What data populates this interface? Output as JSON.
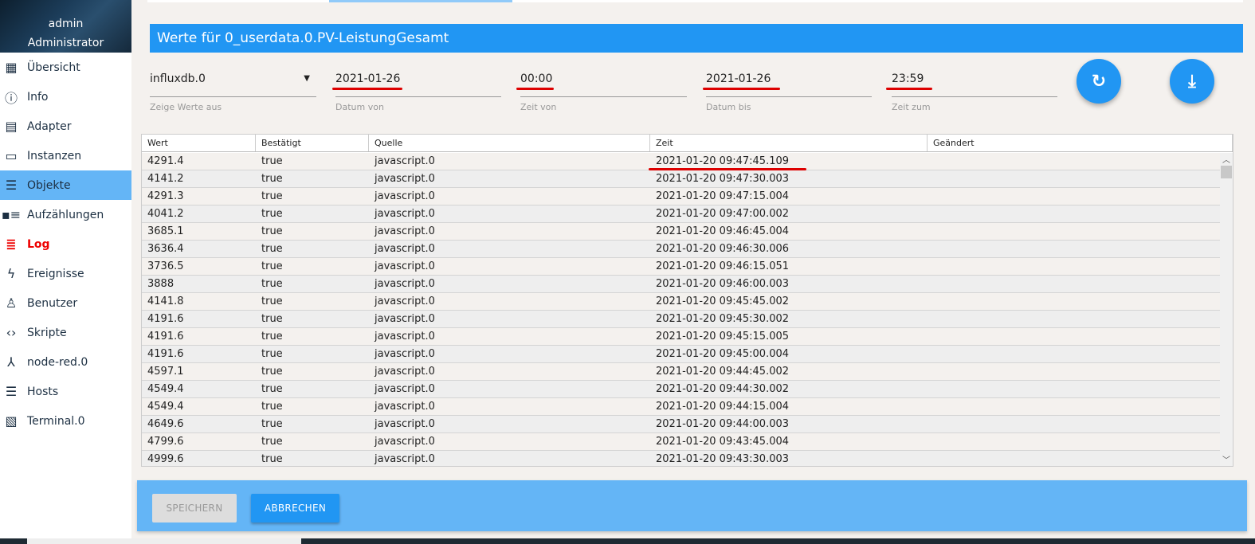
{
  "user": {
    "name": "admin",
    "role": "Administrator"
  },
  "nav": [
    {
      "label": "Übersicht",
      "icon": "grid-icon"
    },
    {
      "label": "Info",
      "icon": "info-icon"
    },
    {
      "label": "Adapter",
      "icon": "store-icon"
    },
    {
      "label": "Instanzen",
      "icon": "instances-icon"
    },
    {
      "label": "Objekte",
      "icon": "list-icon",
      "selected": true
    },
    {
      "label": "Aufzählungen",
      "icon": "enum-icon"
    },
    {
      "label": "Log",
      "icon": "log-icon"
    },
    {
      "label": "Ereignisse",
      "icon": "flash-icon"
    },
    {
      "label": "Benutzer",
      "icon": "user-icon"
    },
    {
      "label": "Skripte",
      "icon": "code-icon"
    },
    {
      "label": "node-red.0",
      "icon": "node-red-icon"
    },
    {
      "label": "Hosts",
      "icon": "hosts-icon"
    },
    {
      "label": "Terminal.0",
      "icon": "terminal-image-icon"
    }
  ],
  "dialog": {
    "title": "Werte für 0_userdata.0.PV-LeistungGesamt",
    "instance": {
      "value": "influxdb.0",
      "label": "Zeige Werte aus"
    },
    "date_from": {
      "value": "2021-01-26",
      "label": "Datum von"
    },
    "time_from": {
      "value": "00:00",
      "label": "Zeit von"
    },
    "date_to": {
      "value": "2021-01-26",
      "label": "Datum bis"
    },
    "time_to": {
      "value": "23:59",
      "label": "Zeit zum"
    },
    "save": "SPEICHERN",
    "cancel": "ABBRECHEN"
  },
  "colors": {
    "accent": "#2196f3",
    "selected": "#64b5f6",
    "log": "#e00000",
    "annotation": "#d00000"
  },
  "table": {
    "columns": [
      "Wert",
      "Bestätigt",
      "Quelle",
      "Zeit",
      "Geändert"
    ],
    "rows": [
      [
        "4291.4",
        "true",
        "javascript.0",
        "2021-01-20 09:47:45.109",
        ""
      ],
      [
        "4141.2",
        "true",
        "javascript.0",
        "2021-01-20 09:47:30.003",
        ""
      ],
      [
        "4291.3",
        "true",
        "javascript.0",
        "2021-01-20 09:47:15.004",
        ""
      ],
      [
        "4041.2",
        "true",
        "javascript.0",
        "2021-01-20 09:47:00.002",
        ""
      ],
      [
        "3685.1",
        "true",
        "javascript.0",
        "2021-01-20 09:46:45.004",
        ""
      ],
      [
        "3636.4",
        "true",
        "javascript.0",
        "2021-01-20 09:46:30.006",
        ""
      ],
      [
        "3736.5",
        "true",
        "javascript.0",
        "2021-01-20 09:46:15.051",
        ""
      ],
      [
        "3888",
        "true",
        "javascript.0",
        "2021-01-20 09:46:00.003",
        ""
      ],
      [
        "4141.8",
        "true",
        "javascript.0",
        "2021-01-20 09:45:45.002",
        ""
      ],
      [
        "4191.6",
        "true",
        "javascript.0",
        "2021-01-20 09:45:30.002",
        ""
      ],
      [
        "4191.6",
        "true",
        "javascript.0",
        "2021-01-20 09:45:15.005",
        ""
      ],
      [
        "4191.6",
        "true",
        "javascript.0",
        "2021-01-20 09:45:00.004",
        ""
      ],
      [
        "4597.1",
        "true",
        "javascript.0",
        "2021-01-20 09:44:45.002",
        ""
      ],
      [
        "4549.4",
        "true",
        "javascript.0",
        "2021-01-20 09:44:30.002",
        ""
      ],
      [
        "4549.4",
        "true",
        "javascript.0",
        "2021-01-20 09:44:15.004",
        ""
      ],
      [
        "4649.6",
        "true",
        "javascript.0",
        "2021-01-20 09:44:00.003",
        ""
      ],
      [
        "4799.6",
        "true",
        "javascript.0",
        "2021-01-20 09:43:45.004",
        ""
      ],
      [
        "4999.6",
        "true",
        "javascript.0",
        "2021-01-20 09:43:30.003",
        ""
      ]
    ]
  }
}
